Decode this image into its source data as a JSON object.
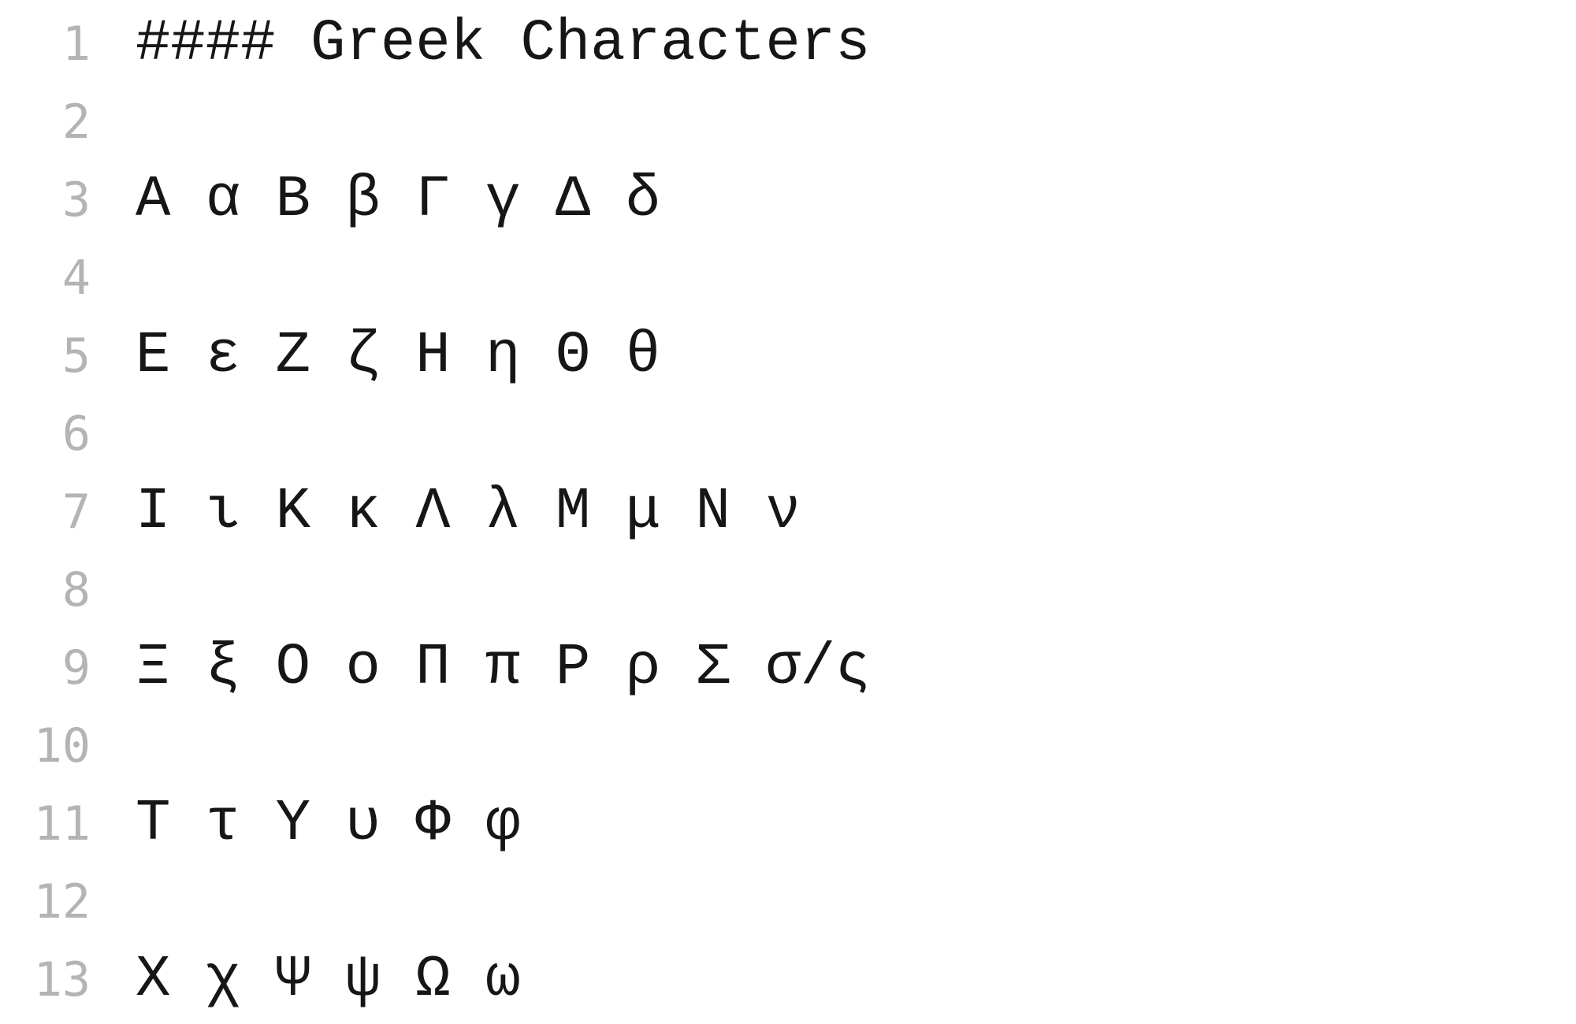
{
  "editor": {
    "lines": [
      {
        "number": "1",
        "text": "#### Greek Characters"
      },
      {
        "number": "2",
        "text": ""
      },
      {
        "number": "3",
        "text": "Α α Β β Γ γ Δ δ"
      },
      {
        "number": "4",
        "text": ""
      },
      {
        "number": "5",
        "text": "Ε ε Ζ ζ Η η Θ θ"
      },
      {
        "number": "6",
        "text": ""
      },
      {
        "number": "7",
        "text": "Ι ι Κ κ Λ λ Μ μ Ν ν"
      },
      {
        "number": "8",
        "text": ""
      },
      {
        "number": "9",
        "text": "Ξ ξ Ο ο Π π Ρ ρ Σ σ/ς"
      },
      {
        "number": "10",
        "text": ""
      },
      {
        "number": "11",
        "text": "Τ τ Υ υ Φ φ"
      },
      {
        "number": "12",
        "text": ""
      },
      {
        "number": "13",
        "text": "Χ χ Ψ ψ Ω ω"
      }
    ]
  }
}
